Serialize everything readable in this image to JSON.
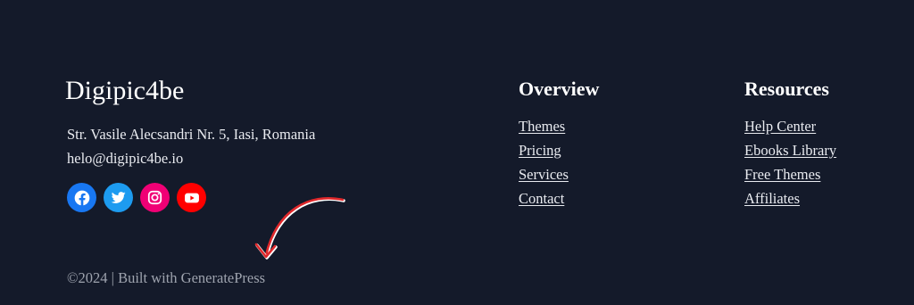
{
  "brand": {
    "name": "Digipic4be",
    "address": "Str. Vasile Alecsandri Nr. 5, Iasi, Romania",
    "email": "helo@digipic4be.io"
  },
  "socials": [
    {
      "icon": "facebook-icon",
      "color": "#1877f2"
    },
    {
      "icon": "twitter-icon",
      "color": "#1d9bf0"
    },
    {
      "icon": "instagram-icon",
      "color": "#f00075"
    },
    {
      "icon": "youtube-icon",
      "color": "#ff0000"
    }
  ],
  "overview": {
    "title": "Overview",
    "links": [
      "Themes",
      "Pricing",
      "Services",
      "Contact"
    ]
  },
  "resources": {
    "title": "Resources",
    "links": [
      "Help Center",
      "Ebooks Library",
      "Free Themes",
      "Affiliates"
    ]
  },
  "copyright": "©2024 | Built with GeneratePress",
  "colors": {
    "background": "#141a2a",
    "arrow": "#e0282b",
    "muted_text": "#9ea3ae"
  }
}
